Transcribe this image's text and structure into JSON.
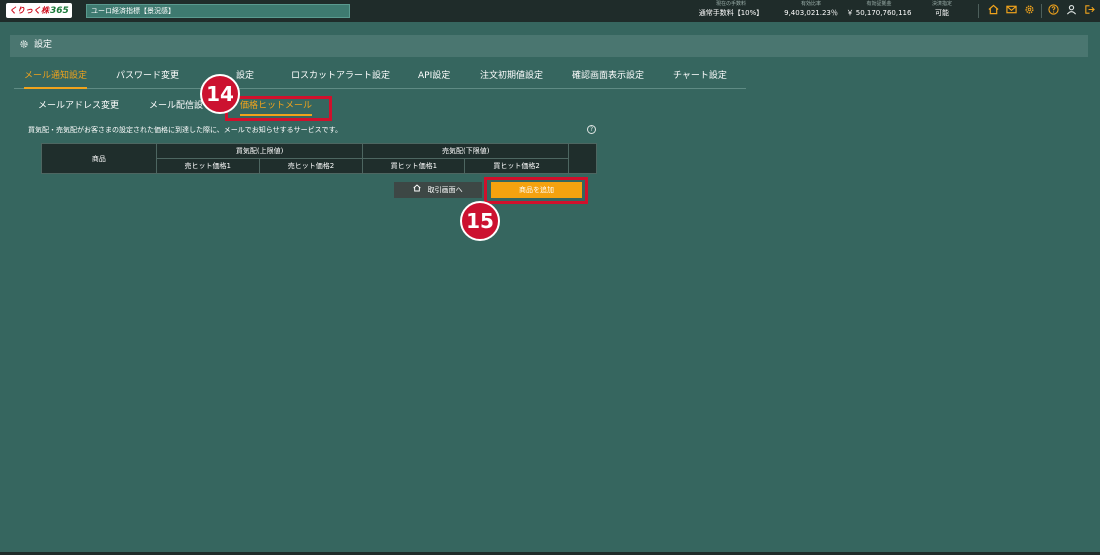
{
  "header": {
    "logo": "くりっく株",
    "logo_sub": "365",
    "ticker": "ユーロ経済指標【景況感】",
    "stats": [
      {
        "label": "現在の手数料",
        "value": "通常手数料【10%】"
      },
      {
        "label": "有効比率",
        "value": "9,403,021.23％"
      },
      {
        "label": "有効証拠金",
        "value": "￥ 50,170,760,116"
      },
      {
        "label": "決済指定",
        "value": "可能"
      }
    ],
    "icons": [
      "home-icon",
      "mail-icon",
      "gear-icon",
      "help-icon",
      "user-icon",
      "logout-icon"
    ]
  },
  "settings": {
    "title": "設定"
  },
  "main_tabs": [
    "メール通知設定",
    "パスワード変更",
    "設定",
    "ロスカットアラート設定",
    "API設定",
    "注文初期値設定",
    "確認画面表示設定",
    "チャート設定"
  ],
  "sub_tabs": [
    "メールアドレス変更",
    "メール配信設",
    "価格ヒットメール"
  ],
  "description": "買気配・売気配がお客さまの設定された価格に到達した際に、メールでお知らせするサービスです。",
  "help_label": "?",
  "table": {
    "product": "商品",
    "buy_group": "買気配(上限値)",
    "sell_group": "売気配(下限値)",
    "cols": [
      "売ヒット価格1",
      "売ヒット価格2",
      "買ヒット価格1",
      "買ヒット価格2"
    ]
  },
  "buttons": {
    "back": "取引画面へ",
    "add": "商品を追加"
  },
  "annotations": [
    "14",
    "15"
  ],
  "colors": {
    "accent": "#f0a31c",
    "highlight": "#d0102c",
    "background": "#36665f"
  }
}
